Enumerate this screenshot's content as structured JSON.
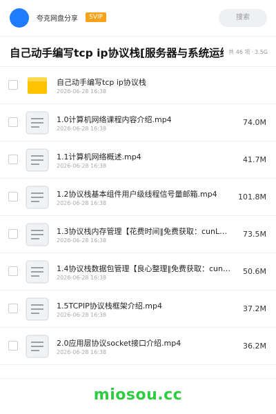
{
  "header": {
    "site_name": "夸克网盘分享",
    "badge": "SVIP",
    "search_placeholder": "搜索",
    "avatar_color": "#1f7bff",
    "badge_color": "#f7a21b"
  },
  "share": {
    "title": "自己动手编写tcp ip协议栈[服务器与系统运维]",
    "count_text": "共 46 项",
    "separator": "·",
    "total_size": "3.5G"
  },
  "files": [
    {
      "name": "自己动手编写tcp ip协议栈",
      "date": "2026-06-28 16:38",
      "size": "",
      "icon": "folder-icon"
    },
    {
      "name": "1.0计算机网络课程内容介绍.mp4",
      "date": "2026-06-28 16:38",
      "size": "74.0M",
      "icon": "file-icon"
    },
    {
      "name": "1.1计算机网络概述.mp4",
      "date": "2026-06-28 16:38",
      "size": "41.7M",
      "icon": "file-icon"
    },
    {
      "name": "1.2协议栈基本组件用户级线程信号量邮箱.mp4",
      "date": "2026-06-28 16:38",
      "size": "101.8M",
      "icon": "file-icon"
    },
    {
      "name": "1.3协议栈内存管理【花费时间‖免费获取：cunL…",
      "date": "2026-06-28 16:38",
      "size": "73.5M",
      "icon": "file-icon"
    },
    {
      "name": "1.4协议栈数据包管理【良心整理‖免费获取：cun…",
      "date": "2026-06-28 16:38",
      "size": "50.6M",
      "icon": "file-icon"
    },
    {
      "name": "1.5TCPIP协议栈框架介绍.mp4",
      "date": "2026-06-28 16:38",
      "size": "37.2M",
      "icon": "file-icon"
    },
    {
      "name": "2.0应用层协议socket接口介绍.mp4",
      "date": "2026-06-28 16:38",
      "size": "36.2M",
      "icon": "file-icon"
    }
  ],
  "footer": {
    "watermark": "miosou.cc",
    "watermark_color": "#2ecc40"
  }
}
